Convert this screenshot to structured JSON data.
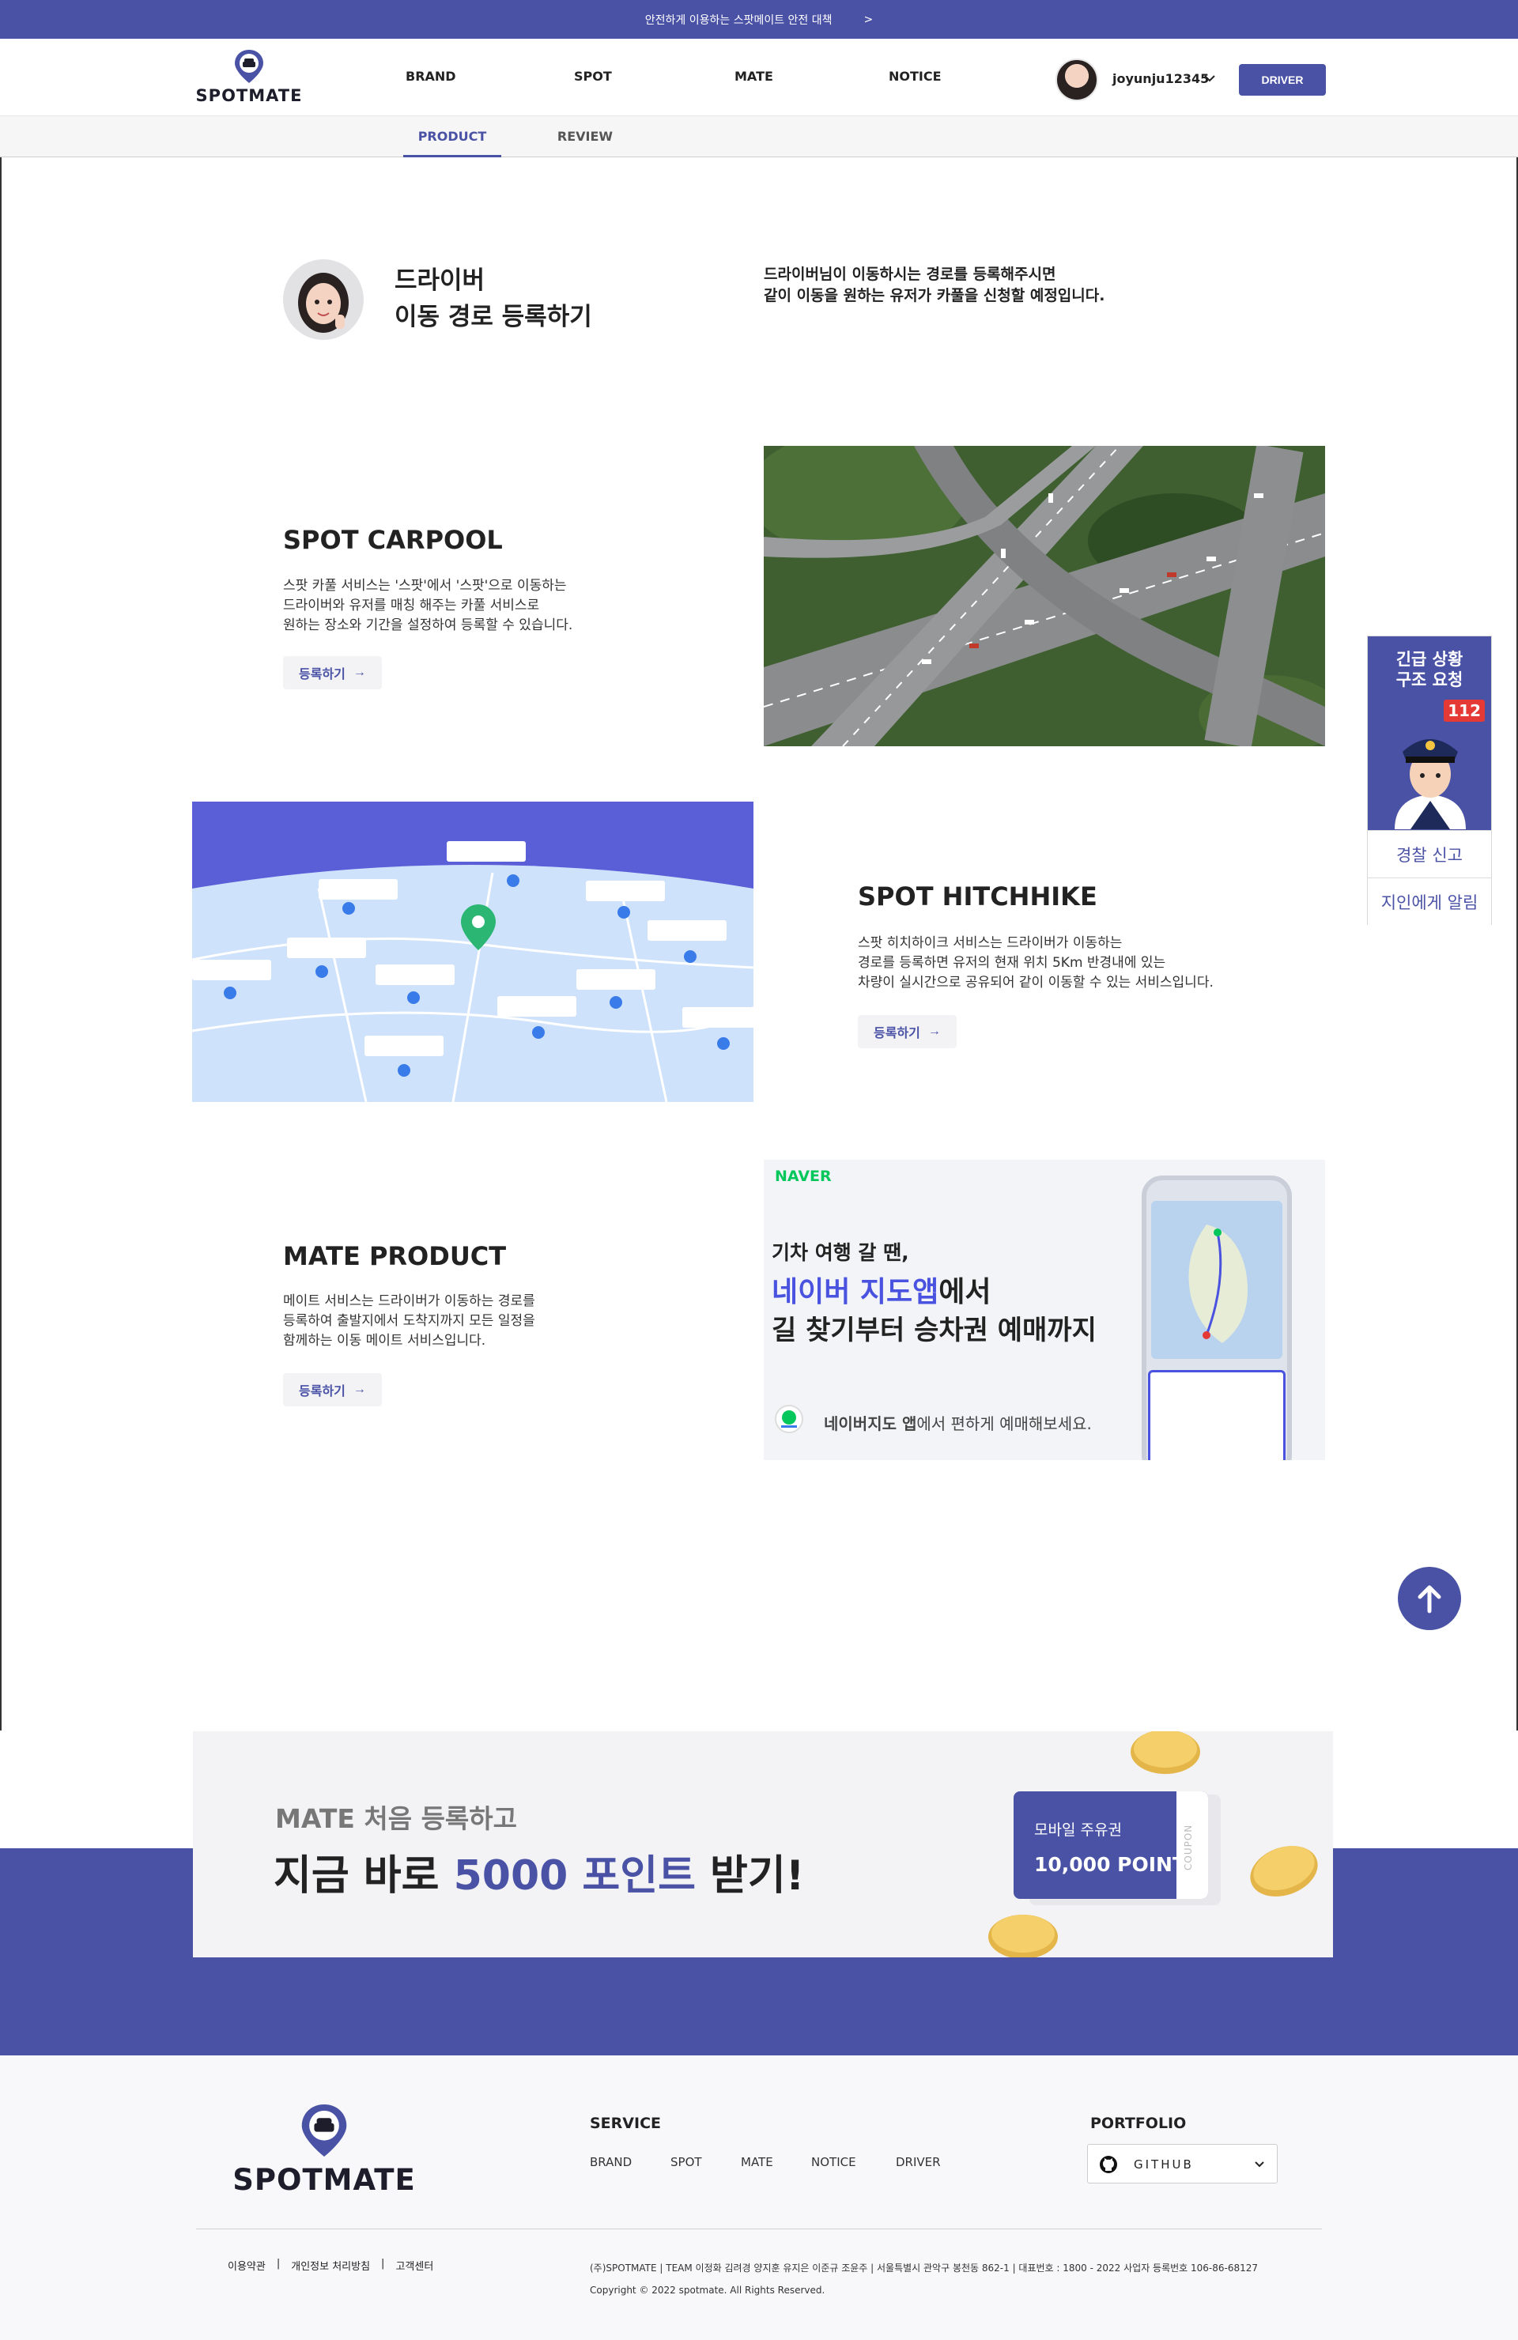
{
  "topbar": {
    "notice": "안전하게 이용하는 스팟메이트 안전 대책",
    "arrow": ">"
  },
  "header": {
    "logo": "SPOTMATE",
    "nav": [
      "BRAND",
      "SPOT",
      "MATE",
      "NOTICE"
    ],
    "username": "joyunju12345",
    "driver_label": "DRIVER"
  },
  "tabs": [
    "PRODUCT",
    "REVIEW"
  ],
  "intro": {
    "title_line1": "드라이버",
    "title_line2": "이동 경로 등록하기",
    "desc_line1": "드라이버님이 이동하시는 경로를 등록해주시면",
    "desc_line2": "같이 이동을 원하는 유저가 카풀을 신청할 예정입니다."
  },
  "carpool": {
    "title": "SPOT CARPOOL",
    "desc": [
      "스팟 카풀 서비스는 '스팟'에서 '스팟'으로 이동하는",
      "드라이버와 유저를 매칭 해주는 카풀 서비스로",
      "원하는 장소와 기간을 설정하여 등록할 수 있습니다."
    ],
    "button": "등록하기"
  },
  "hitchhike": {
    "title": "SPOT HITCHHIKE",
    "desc": [
      "스팟 히치하이크 서비스는 드라이버가 이동하는",
      "경로를 등록하면 유저의 현재 위치 5Km 반경내에 있는",
      "차량이 실시간으로 공유되어 같이 이동할 수 있는 서비스입니다."
    ],
    "button": "등록하기"
  },
  "mate": {
    "title": "MATE PRODUCT",
    "desc": [
      "메이트 서비스는 드라이버가 이동하는 경로를",
      "등록하여 출발지에서 도착지까지 모든 일정을",
      "함께하는 이동 메이트 서비스입니다."
    ],
    "button": "등록하기"
  },
  "naver_ad": {
    "brand": "NAVER",
    "line1": "기차 여행 갈 땐,",
    "line2_accent": "네이버 지도앱",
    "line2_rest": "에서",
    "line3": "길 찾기부터 승차권 예매까지",
    "footer_bold": "네이버지도 앱",
    "footer_rest": "에서 편하게 예매해보세요."
  },
  "emergency": {
    "title_line1": "긴급 상황",
    "title_line2": "구조 요청",
    "badge": "112",
    "police": "경찰 신고",
    "notify": "지인에게 알림"
  },
  "promo": {
    "small": "MATE 처음 등록하고",
    "big_before": "지금 바로 ",
    "big_accent": "5000 포인트",
    "big_after": " 받기!",
    "coupon_label": "모바일 주유권",
    "coupon_value": "10,000 POINT",
    "coupon_side": "COUPON"
  },
  "footer": {
    "logo": "SPOTMATE",
    "service_head": "SERVICE",
    "service_links": [
      "BRAND",
      "SPOT",
      "MATE",
      "NOTICE",
      "DRIVER"
    ],
    "portfolio_head": "PORTFOLIO",
    "github": "GITHUB",
    "legal_links": [
      "이용약관",
      "개인정보 처리방침",
      "고객센터"
    ],
    "separator": "|",
    "company_info": "(주)SPOTMATE | TEAM 이정화 김려경 양지훈 유지은 이준규 조윤주 | 서울특별시 관악구 봉천동 862-1 | 대표번호 : 1800 - 2022 사업자 등록번호 106-86-68127",
    "copyright": "Copyright © 2022 spotmate. All Rights Reserved."
  },
  "colors": {
    "brand": "#4a52a6",
    "naver_green": "#03c75a",
    "alert_red": "#e53935"
  }
}
